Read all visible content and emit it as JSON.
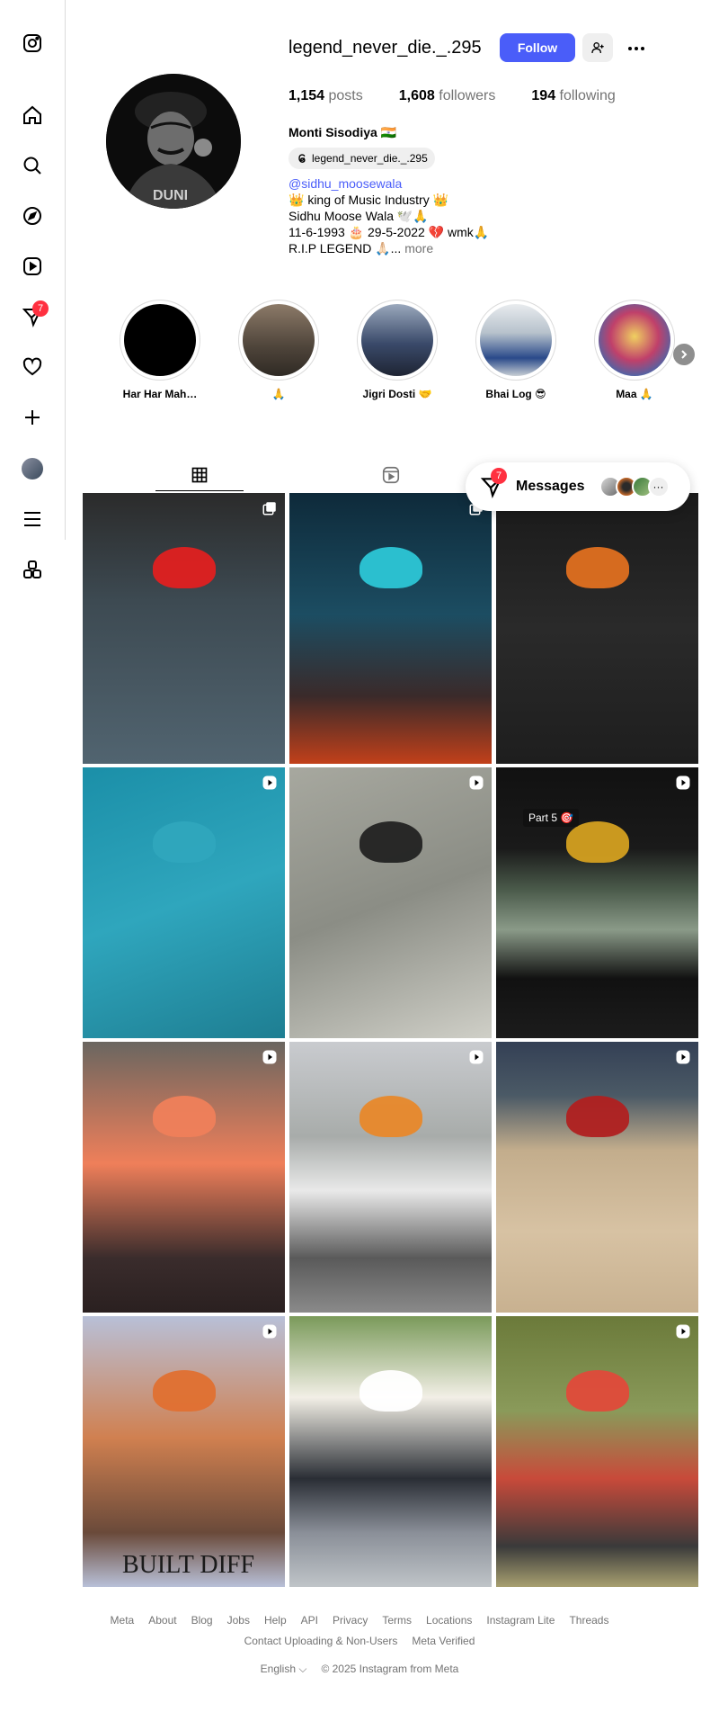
{
  "profile": {
    "username": "legend_never_die._.295",
    "follow_label": "Follow",
    "stats": {
      "posts_count": "1,154",
      "posts_label": "posts",
      "followers_count": "1,608",
      "followers_label": "followers",
      "following_count": "194",
      "following_label": "following"
    },
    "full_name": "Monti Sisodiya 🇮🇳",
    "threads_handle": "legend_never_die._.295",
    "bio": {
      "mention": "@sidhu_moosewala",
      "line1": "👑 king of Music Industry 👑",
      "line2": "Sidhu Moose Wala 🕊️🙏",
      "line3": "11-6-1993 🎂 29-5-2022 💔 wmk🙏",
      "line4": "R.I.P LEGEND 🙏🏻...",
      "more": "more"
    }
  },
  "highlights": [
    {
      "label": "Har Har Mah…",
      "color": "#000000"
    },
    {
      "label": "🙏",
      "color": "#6b5d4f"
    },
    {
      "label": "Jigri Dosti 🤝",
      "color": "#3a4a6a"
    },
    {
      "label": "Bhai Log 😎",
      "color": "#b7c2cc"
    },
    {
      "label": "Maa 🙏",
      "color": "#c0406a"
    }
  ],
  "messages": {
    "label": "Messages",
    "badge": "7",
    "more": "···"
  },
  "notifications_badge": "7",
  "tiles": [
    {
      "kind": "carousel",
      "bg": "linear-gradient(180deg,#2b2b2b 0%,#3d4a52 40%,#516470 100%)",
      "accent": "#e02020"
    },
    {
      "kind": "carousel",
      "bg": "linear-gradient(180deg,#0e2a3a 0%,#1c4d62 45%,#3a2a2a 75%,#c2401a 100%)",
      "accent": "#2cc6d6"
    },
    {
      "kind": "none",
      "bg": "linear-gradient(180deg,#1a1a1a 0%,#2a2a2a 50%,#1e1e1e 100%)",
      "accent": "#e07020"
    },
    {
      "kind": "reel",
      "bg": "linear-gradient(160deg,#1b8fa8 0%,#2fa6bd 50%,#1e7e92 100%)",
      "accent": "#2fa6bd"
    },
    {
      "kind": "reel",
      "bg": "linear-gradient(160deg,#a7a89f 0%,#8b8d85 50%,#cfcfc7 100%)",
      "accent": "#222"
    },
    {
      "kind": "reel",
      "bg": "linear-gradient(180deg,#111 0%,#1a1a1a 30%,#4a5a4a 45%,#8a9a88 60%,#111 78%,#1c1c1c 100%)",
      "accent": "#d4a020",
      "caption": "Part 5 🎯"
    },
    {
      "kind": "reel",
      "bg": "linear-gradient(180deg,#6a6660 0%,#ef7f5a 45%,#3a2c2c 80%,#2a2020 100%)",
      "accent": "#ef7f5a"
    },
    {
      "kind": "reel",
      "bg": "linear-gradient(180deg,#c9cbcf 0%,#a8acaa 35%,#e9e9e9 55%,#5a5a5a 80%,#8a8a8a 100%)",
      "accent": "#e8882a"
    },
    {
      "kind": "reel",
      "bg": "linear-gradient(180deg,#344055 0%,#4b5a66 20%,#c3ad8c 40%,#d7c2a3 70%,#c8b190 100%)",
      "accent": "#b02020"
    },
    {
      "kind": "reel",
      "bg": "linear-gradient(180deg,#b8c0d8 0%,#d08050 45%,#6a4a3a 80%,#b8c0d8 100%)",
      "accent": "#e07030",
      "caption": "BUILT DIFF"
    },
    {
      "kind": "none",
      "bg": "linear-gradient(180deg,#7a9a5a 0%,#f2efe6 30%,#2a2e35 60%,#8a8f98 80%,#bfc4c8 100%)",
      "accent": "#fff"
    },
    {
      "kind": "reel",
      "bg": "linear-gradient(180deg,#6b7a3a 0%,#8a9a5a 35%,#c84a3a 60%,#3a3a3a 85%,#a8a070 100%)",
      "accent": "#e04a3a"
    }
  ],
  "footer": {
    "links": [
      "Meta",
      "About",
      "Blog",
      "Jobs",
      "Help",
      "API",
      "Privacy",
      "Terms",
      "Locations",
      "Instagram Lite",
      "Threads"
    ],
    "links2": [
      "Contact Uploading & Non-Users",
      "Meta Verified"
    ],
    "language": "English",
    "copyright": "© 2025 Instagram from Meta"
  }
}
